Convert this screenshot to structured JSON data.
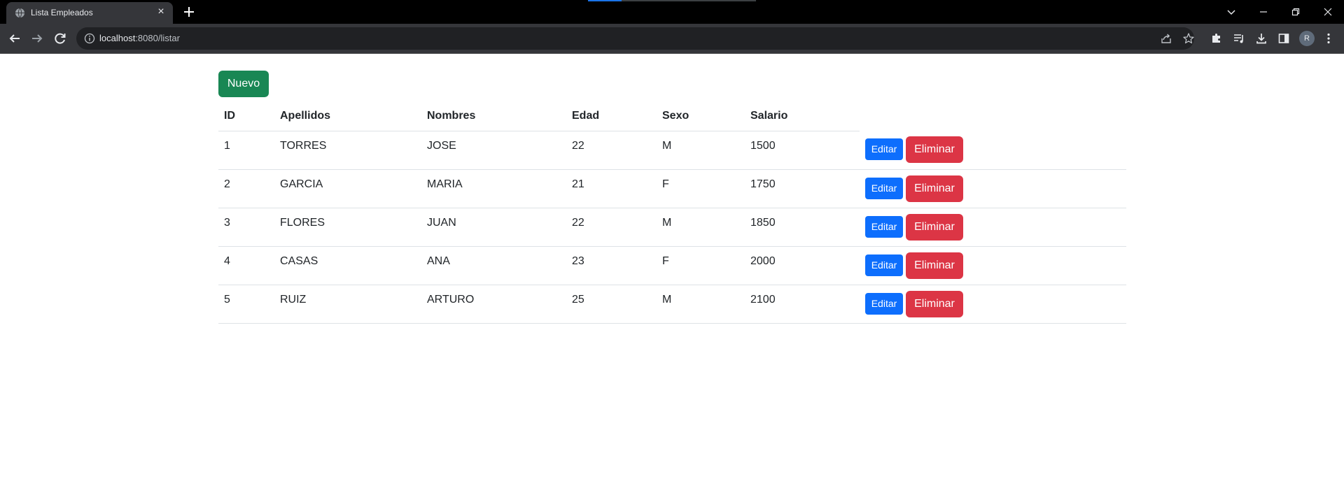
{
  "browser": {
    "tab_title": "Lista Empleados",
    "tab_close": "×",
    "url_host": "localhost",
    "url_path": ":8080/listar",
    "profile_initial": "R"
  },
  "page": {
    "new_button": "Nuevo",
    "table": {
      "headers": [
        "ID",
        "Apellidos",
        "Nombres",
        "Edad",
        "Sexo",
        "Salario"
      ],
      "rows": [
        {
          "id": "1",
          "apellidos": "TORRES",
          "nombres": "JOSE",
          "edad": "22",
          "sexo": "M",
          "salario": "1500"
        },
        {
          "id": "2",
          "apellidos": "GARCIA",
          "nombres": "MARIA",
          "edad": "21",
          "sexo": "F",
          "salario": "1750"
        },
        {
          "id": "3",
          "apellidos": "FLORES",
          "nombres": "JUAN",
          "edad": "22",
          "sexo": "M",
          "salario": "1850"
        },
        {
          "id": "4",
          "apellidos": "CASAS",
          "nombres": "ANA",
          "edad": "23",
          "sexo": "F",
          "salario": "2000"
        },
        {
          "id": "5",
          "apellidos": "RUIZ",
          "nombres": "ARTURO",
          "edad": "25",
          "sexo": "M",
          "salario": "2100"
        }
      ],
      "edit_label": "Editar",
      "delete_label": "Eliminar"
    }
  },
  "colors": {
    "new_button": "#198754",
    "edit_button": "#0d6efd",
    "delete_button": "#dc3545"
  },
  "icons": {
    "tab": "globe-icon",
    "toolbar": [
      "back-arrow-icon",
      "forward-arrow-icon",
      "reload-icon",
      "info-icon",
      "share-icon",
      "star-icon",
      "extensions-icon",
      "reading-list-icon",
      "download-icon",
      "side-panel-icon",
      "more-vert-icon"
    ]
  }
}
